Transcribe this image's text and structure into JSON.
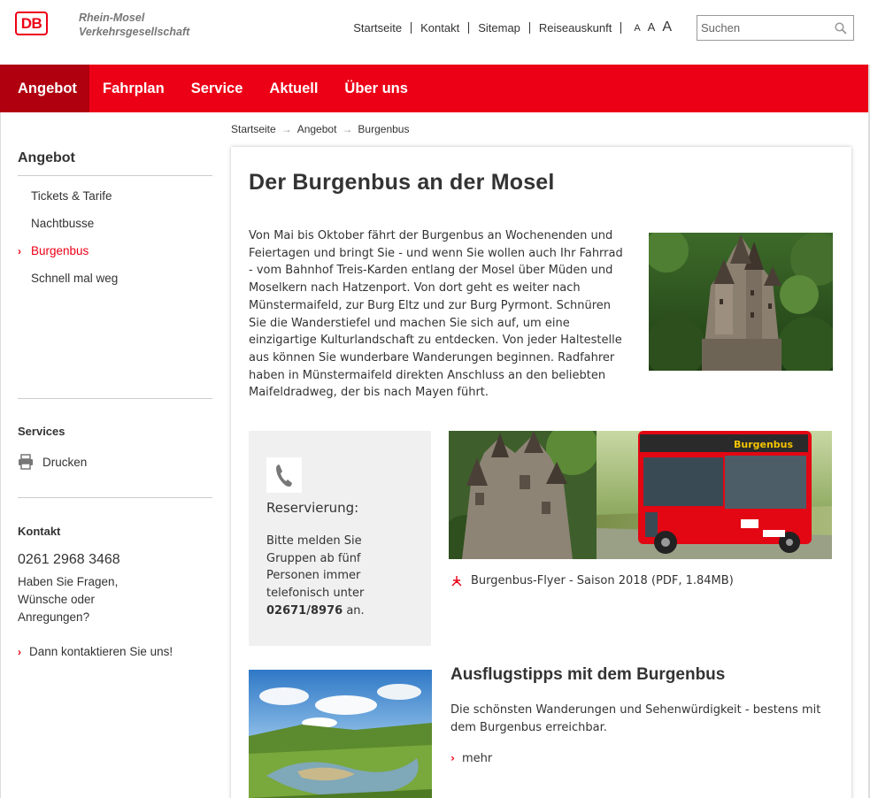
{
  "brand": {
    "logo_text": "DB",
    "company_line1": "Rhein-Mosel",
    "company_line2": "Verkehrsgesellschaft",
    "accent_color": "#ec0016",
    "accent_dark": "#b0000f"
  },
  "topnav": {
    "items": [
      "Startseite",
      "Kontakt",
      "Sitemap",
      "Reiseauskunft"
    ],
    "font_sizes": [
      "A",
      "A",
      "A"
    ]
  },
  "search": {
    "placeholder": "Suchen"
  },
  "mainnav": {
    "items": [
      "Angebot",
      "Fahrplan",
      "Service",
      "Aktuell",
      "Über uns"
    ],
    "active": "Angebot"
  },
  "breadcrumb": {
    "items": [
      "Startseite",
      "Angebot",
      "Burgenbus"
    ],
    "separator": "→"
  },
  "sidebar": {
    "title": "Angebot",
    "items": [
      "Tickets & Tarife",
      "Nachtbusse",
      "Burgenbus",
      "Schnell mal weg"
    ],
    "active": "Burgenbus",
    "services_title": "Services",
    "print_label": "Drucken",
    "contact_title": "Kontakt",
    "phone": "0261 2968 3468",
    "contact_text": "Haben Sie Fragen, Wünsche oder Anregungen?",
    "contact_link": "Dann kontaktieren Sie uns!"
  },
  "content": {
    "title": "Der Burgenbus an der Mosel",
    "intro": "Von Mai bis Oktober fährt der Burgenbus an Wochenenden und Feiertagen und bringt Sie - und wenn Sie wollen auch Ihr Fahrrad - vom Bahnhof Treis-Karden entlang der Mosel über Müden und Moselkern nach Hatzenport. Von dort geht es weiter nach Münstermaifeld, zur Burg Eltz und zur Burg Pyrmont. Schnüren Sie die Wanderstiefel und machen Sie sich auf, um eine einzigartige Kulturlandschaft zu entdecken. Von jeder Haltestelle aus können Sie wunderbare Wanderungen beginnen. Radfahrer haben in Münstermaifeld direkten Anschluss an den beliebten Maifeldradweg, der bis nach Mayen führt.",
    "reservation": {
      "title": "Reservierung:",
      "text_before": "Bitte melden Sie Gruppen ab fünf Personen immer telefonisch unter",
      "phone": "02671/8976",
      "text_after": "an."
    },
    "bus_label": "Burgenbus",
    "flyer_link": "Burgenbus-Flyer - Saison 2018 (PDF, 1.84MB)",
    "tips": {
      "title": "Ausflugstipps mit dem Burgenbus",
      "text": "Die schönsten Wanderungen und Sehenwürdigkeit - bestens mit dem Burgenbus erreichbar.",
      "link": "mehr"
    }
  }
}
